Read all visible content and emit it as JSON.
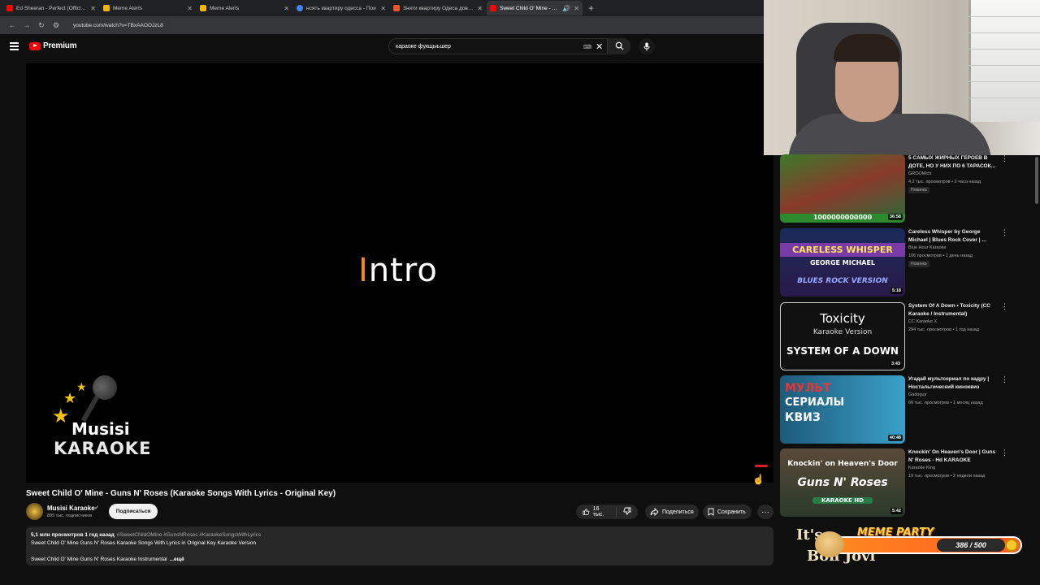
{
  "browser": {
    "tabs": [
      {
        "title": "Ed Sheeran - Perfect (Official M",
        "favicon_color": "#ff0000",
        "active": false
      },
      {
        "title": "Meme Alerts",
        "favicon_color": "#f5b400",
        "active": false
      },
      {
        "title": "Meme Alerts",
        "favicon_color": "#f5b400",
        "active": false
      },
      {
        "title": "нсять квартиру одесса - Пои",
        "favicon_color": "#4285f4",
        "active": false
      },
      {
        "title": "Зняти квартиру Одеса довгос",
        "favicon_color": "#e8562a",
        "active": false
      },
      {
        "title": "Sweet Child O' Mine - Gun",
        "favicon_color": "#ff0000",
        "active": true
      }
    ],
    "new_tab": "+",
    "url": "youtube.com/watch?v=TBxAAOOJzL8"
  },
  "header": {
    "logo_text": "Premium",
    "search_value": "караоке фукщыьшер",
    "keyboard_icon": "⌨",
    "clear_icon": "✕"
  },
  "player": {
    "lyric_highlight": "I",
    "lyric_rest": "ntro",
    "logo_line1": "Musisi",
    "logo_line2": "KARAOKE"
  },
  "video": {
    "title": "Sweet Child O' Mine - Guns N' Roses (Karaoke Songs With Lyrics - Original Key)",
    "channel": "Musisi Karaoke",
    "verified": "✔",
    "subscribers": "895 тыс. подписчиков",
    "subscribe_label": "Подписаться",
    "likes": "16 тыс.",
    "share_label": "Поделиться",
    "save_label": "Сохранить",
    "more": "···"
  },
  "description": {
    "stats": "5,1 млн просмотров  1 год назад",
    "tags": "#SweetChildOMine #GunsNRoses #KaraokeSongsWithLyrics",
    "line1": "Sweet Child O' Mine Guns N' Roses Karaoke Songs With Lyrics in Original Key Karaoke Version",
    "line2": "Sweet Child O' Mine Guns N' Roses Karaoke Instrumental",
    "more": "...ещё"
  },
  "recommendations": [
    {
      "title": "5 САМЫХ ЖИРНЫХ ГЕРОЕВ В ДОТЕ, НО У НИХ ПО 6 ТАРАСОК...",
      "channel": "GROOMich",
      "views": "4,2 тыс. просмотров • 2 часа назад",
      "badge": "Новинка",
      "duration": "36:58",
      "thumb_text": "1000000000000"
    },
    {
      "title": "Careless Whisper by George Michael | Blues Rock Cover | ...",
      "channel": "Blue Hour Karaoke",
      "views": "106 просмотров • 1 день назад",
      "badge": "Новинка",
      "duration": "5:18",
      "thumb_text": "CARELESS WHISPER",
      "thumb_sub": "GEORGE MICHAEL",
      "thumb_sub2": "BLUES ROCK VERSION"
    },
    {
      "title": "System Of A Down • Toxicity (CC Karaoke / Instrumental)",
      "channel": "CC Karaoke X",
      "views": "294 тыс. просмотров • 1 год назад",
      "badge": "",
      "duration": "3:43",
      "thumb_text": "Toxicity",
      "thumb_sub": "Karaoke Version",
      "thumb_sub2": "SYSTEM OF A DOWN"
    },
    {
      "title": "Угадай мультсериал по кадру | Ностальгический киноквиз",
      "channel": "Gadoguy",
      "views": "66 тыс. просмотров • 1 месяц назад",
      "badge": "",
      "duration": "40:48",
      "thumb_text": "МУЛЬТ",
      "thumb_sub": "СЕРИАЛЫ",
      "thumb_sub2": "КВИЗ"
    },
    {
      "title": "Knockin' On Heaven's Door | Guns N' Roses - Hd KARAOKE",
      "channel": "Karaoke King",
      "views": "19 тыс. просмотров • 2 недели назад",
      "badge": "",
      "duration": "5:42",
      "thumb_text": "Knockin' on Heaven's Door",
      "thumb_sub": "Guns N' Roses",
      "thumb_sub2": "KARAOKE HD"
    }
  ],
  "overlay": {
    "brand": "MEME PARTY",
    "counter": "386 / 500",
    "bg_text": "Bon Jovi",
    "bg_text2": "It's"
  }
}
